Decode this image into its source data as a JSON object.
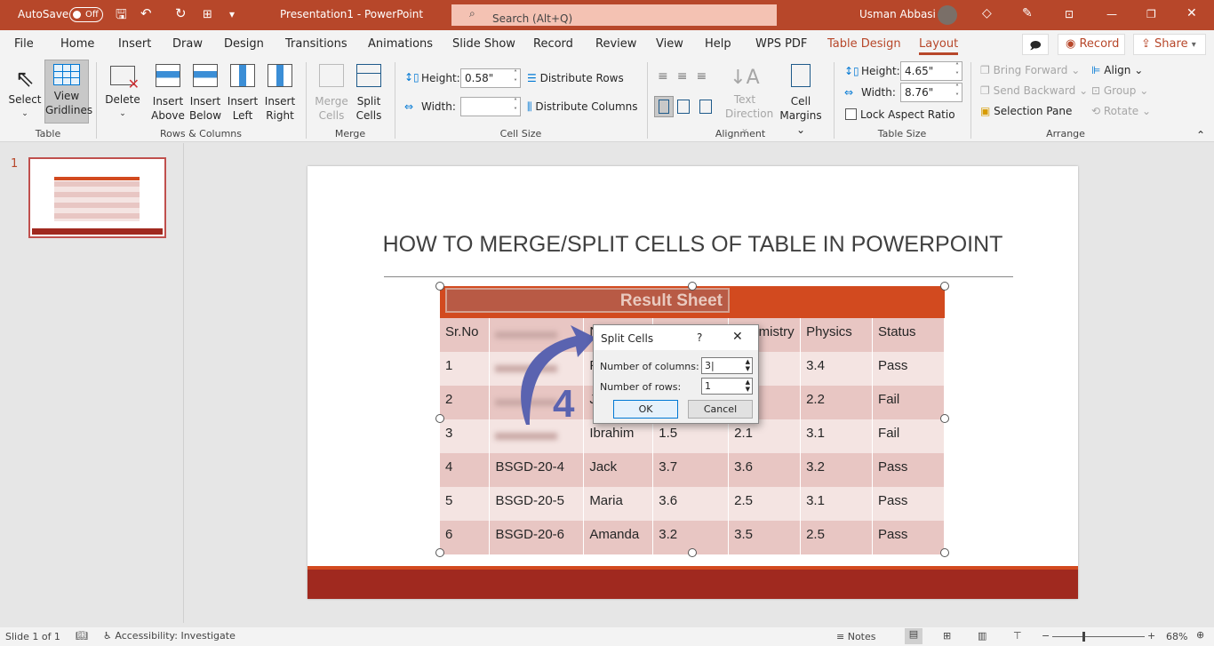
{
  "titlebar": {
    "autosave": "AutoSave",
    "autosave_state": "Off",
    "doc_title": "Presentation1  -  PowerPoint",
    "search_placeholder": "Search (Alt+Q)",
    "user": "Usman Abbasi"
  },
  "menu": {
    "tabs": [
      "File",
      "Home",
      "Insert",
      "Draw",
      "Design",
      "Transitions",
      "Animations",
      "Slide Show",
      "Record",
      "Review",
      "View",
      "Help",
      "WPS PDF",
      "Table Design",
      "Layout"
    ],
    "active": "Layout",
    "record": "Record",
    "share": "Share"
  },
  "ribbon": {
    "table": {
      "select": "Select",
      "view_gridlines": [
        "View",
        "Gridlines"
      ],
      "group": "Table"
    },
    "rows_cols": {
      "delete": "Delete",
      "insert_above": [
        "Insert",
        "Above"
      ],
      "insert_below": [
        "Insert",
        "Below"
      ],
      "insert_left": [
        "Insert",
        "Left"
      ],
      "insert_right": [
        "Insert",
        "Right"
      ],
      "group": "Rows & Columns"
    },
    "merge": {
      "merge_cells": [
        "Merge",
        "Cells"
      ],
      "split_cells": [
        "Split",
        "Cells"
      ],
      "group": "Merge"
    },
    "cell_size": {
      "height_label": "Height:",
      "height_value": "0.58\"",
      "width_label": "Width:",
      "width_value": "",
      "distribute_rows": "Distribute Rows",
      "distribute_columns": "Distribute Columns",
      "group": "Cell Size"
    },
    "alignment": {
      "text_direction": [
        "Text",
        "Direction"
      ],
      "cell_margins": [
        "Cell",
        "Margins"
      ],
      "group": "Alignment"
    },
    "table_size": {
      "height_label": "Height:",
      "height_value": "4.65\"",
      "width_label": "Width:",
      "width_value": "8.76\"",
      "lock": "Lock Aspect Ratio",
      "group": "Table Size"
    },
    "arrange": {
      "bring_forward": "Bring Forward",
      "send_backward": "Send Backward",
      "selection_pane": "Selection Pane",
      "align": "Align",
      "group_btn": "Group",
      "rotate": "Rotate",
      "group": "Arrange"
    }
  },
  "thumbnail": {
    "number": "1"
  },
  "slide": {
    "title": "HOW TO MERGE/SPLIT CELLS OF TABLE IN POWERPOINT",
    "table": {
      "caption": "Result  Sheet",
      "header": [
        "Sr.No",
        "",
        "N",
        "",
        "Chemistry",
        "Physics",
        "Status"
      ],
      "rows": [
        [
          "1",
          "",
          "F",
          "",
          "",
          "3.4",
          "Pass"
        ],
        [
          "2",
          "",
          "J",
          "",
          "",
          "2.2",
          "Fail"
        ],
        [
          "3",
          "",
          "Ibrahim",
          "1.5",
          "2.1",
          "3.1",
          "Fail"
        ],
        [
          "4",
          "BSGD-20-4",
          "Jack",
          "3.7",
          "3.6",
          "3.2",
          "Pass"
        ],
        [
          "5",
          "BSGD-20-5",
          "Maria",
          "3.6",
          "2.5",
          "3.1",
          "Pass"
        ],
        [
          "6",
          "BSGD-20-6",
          "Amanda",
          "3.2",
          "3.5",
          "2.5",
          "Pass"
        ]
      ]
    },
    "step_number": "4"
  },
  "dialog": {
    "title": "Split Cells",
    "help": "?",
    "columns_label": "Number of columns:",
    "columns_value": "3",
    "rows_label": "Number of rows:",
    "rows_value": "1",
    "ok": "OK",
    "cancel": "Cancel"
  },
  "status": {
    "slide": "Slide 1 of 1",
    "accessibility": "Accessibility: Investigate",
    "notes": "Notes",
    "zoom": "68%"
  },
  "colors": {
    "brand": "#b7472a",
    "table_header": "#d24a1f",
    "row_dark": "#e8c6c3",
    "row_light": "#f4e4e2",
    "footer": "#a0291f",
    "arrow": "#5a63b0"
  }
}
